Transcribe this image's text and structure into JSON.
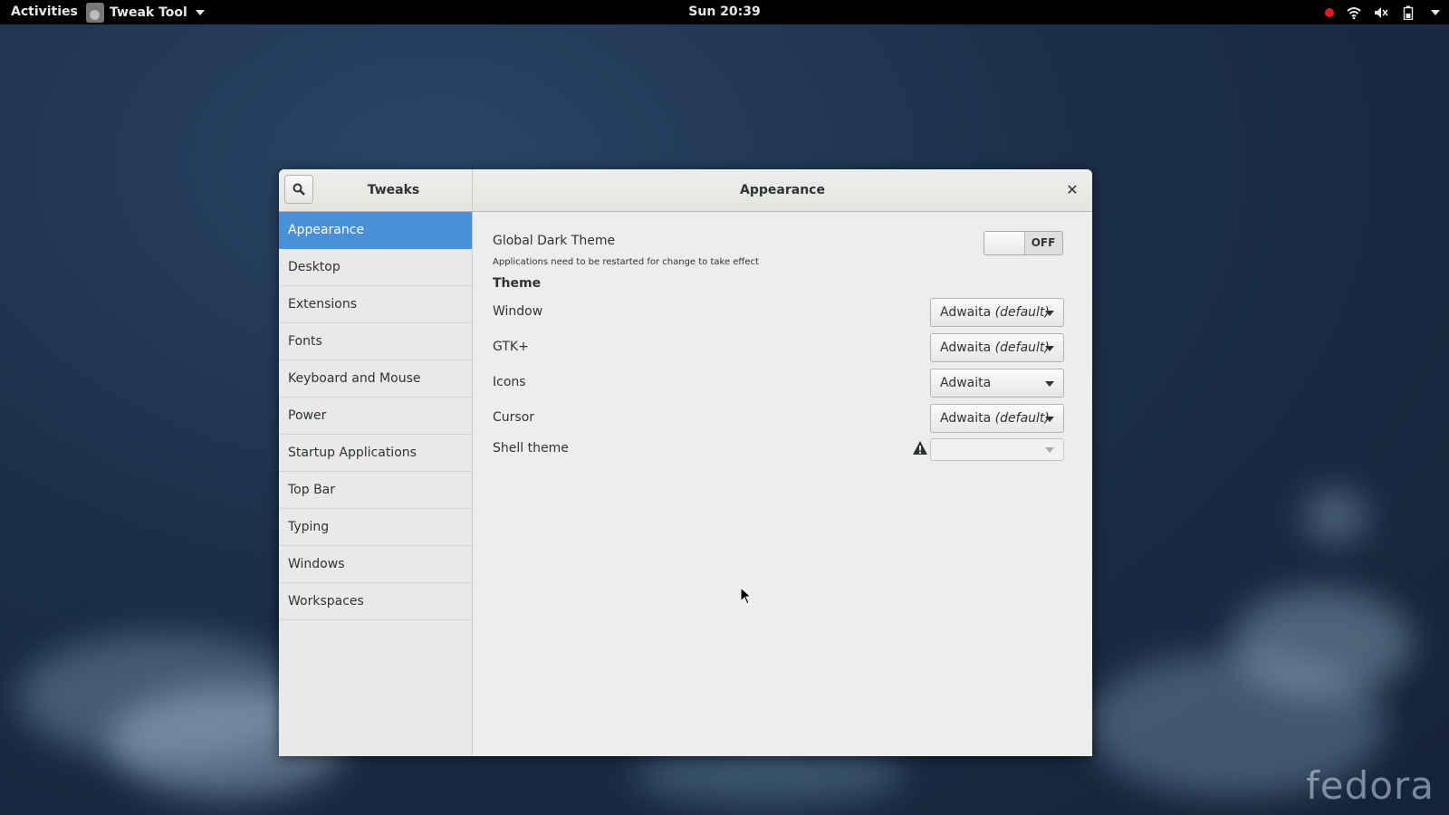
{
  "topbar": {
    "activities": "Activities",
    "app_name": "Tweak Tool",
    "clock": "Sun 20:39"
  },
  "window": {
    "sidebar_title": "Tweaks",
    "page_title": "Appearance",
    "close_symbol": "✕",
    "sidebar_items": [
      {
        "label": "Appearance",
        "selected": true
      },
      {
        "label": "Desktop"
      },
      {
        "label": "Extensions"
      },
      {
        "label": "Fonts"
      },
      {
        "label": "Keyboard and Mouse"
      },
      {
        "label": "Power"
      },
      {
        "label": "Startup Applications"
      },
      {
        "label": "Top Bar"
      },
      {
        "label": "Typing"
      },
      {
        "label": "Windows"
      },
      {
        "label": "Workspaces"
      }
    ],
    "global_dark_theme": {
      "label": "Global Dark Theme",
      "note": "Applications need to be restarted for change to take effect",
      "state": "OFF"
    },
    "theme_section": "Theme",
    "theme_rows": [
      {
        "label": "Window",
        "value": "Adwaita",
        "suffix": "(default)"
      },
      {
        "label": "GTK+",
        "value": "Adwaita",
        "suffix": "(default)"
      },
      {
        "label": "Icons",
        "value": "Adwaita",
        "suffix": ""
      },
      {
        "label": "Cursor",
        "value": "Adwaita",
        "suffix": "(default)"
      },
      {
        "label": "Shell theme",
        "value": "",
        "suffix": "",
        "disabled": true,
        "warning": true
      }
    ]
  },
  "desktop": {
    "watermark": "fedora"
  },
  "colors": {
    "selection": "#4a90d9",
    "topbar": "#000000",
    "record": "#e01b24"
  }
}
